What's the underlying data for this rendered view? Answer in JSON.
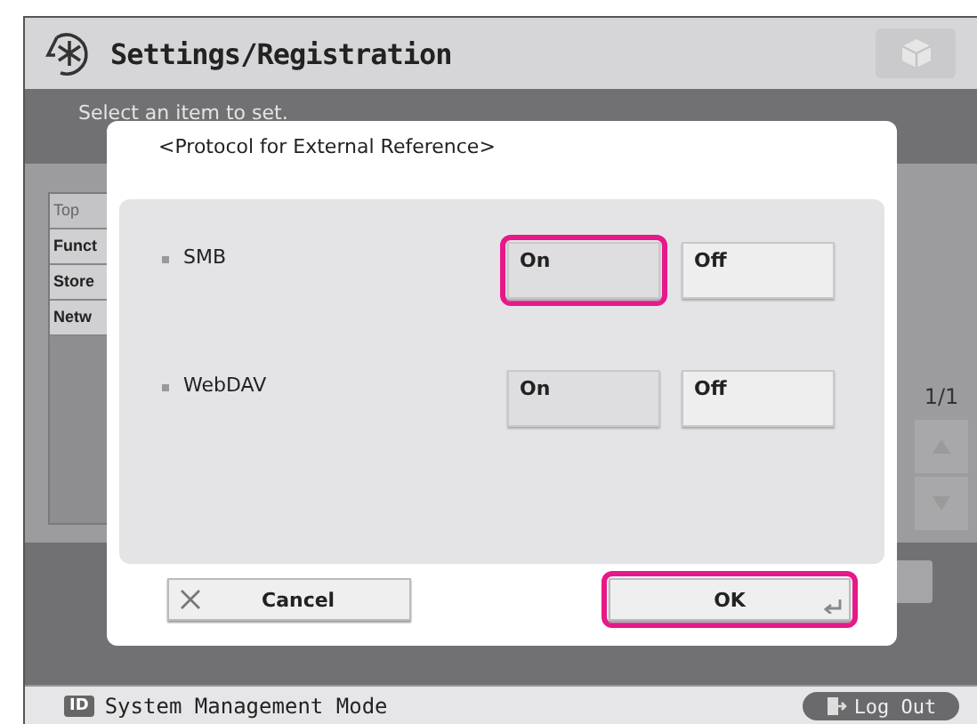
{
  "header": {
    "title": "Settings/Registration"
  },
  "instruction": "Select an item to set.",
  "side_list": [
    {
      "label": "Top",
      "disabled": true
    },
    {
      "label": "Funct",
      "disabled": false
    },
    {
      "label": "Store",
      "disabled": false
    },
    {
      "label": "Netw",
      "disabled": false
    }
  ],
  "pager": {
    "page": "1/1"
  },
  "dialog": {
    "title": "<Protocol for External Reference>",
    "settings": [
      {
        "label": "SMB",
        "options": [
          {
            "label": "On",
            "selected": true,
            "highlighted": true
          },
          {
            "label": "Off",
            "selected": false,
            "highlighted": false
          }
        ]
      },
      {
        "label": "WebDAV",
        "options": [
          {
            "label": "On",
            "selected": true,
            "highlighted": false
          },
          {
            "label": "Off",
            "selected": false,
            "highlighted": false
          }
        ]
      }
    ],
    "buttons": [
      {
        "kind": "cancel",
        "label": "Cancel",
        "highlighted": false
      },
      {
        "kind": "ok",
        "label": "OK",
        "highlighted": true
      }
    ]
  },
  "status_bar": {
    "mode": "System Management Mode",
    "id_badge": "ID",
    "logout": "Log Out"
  }
}
